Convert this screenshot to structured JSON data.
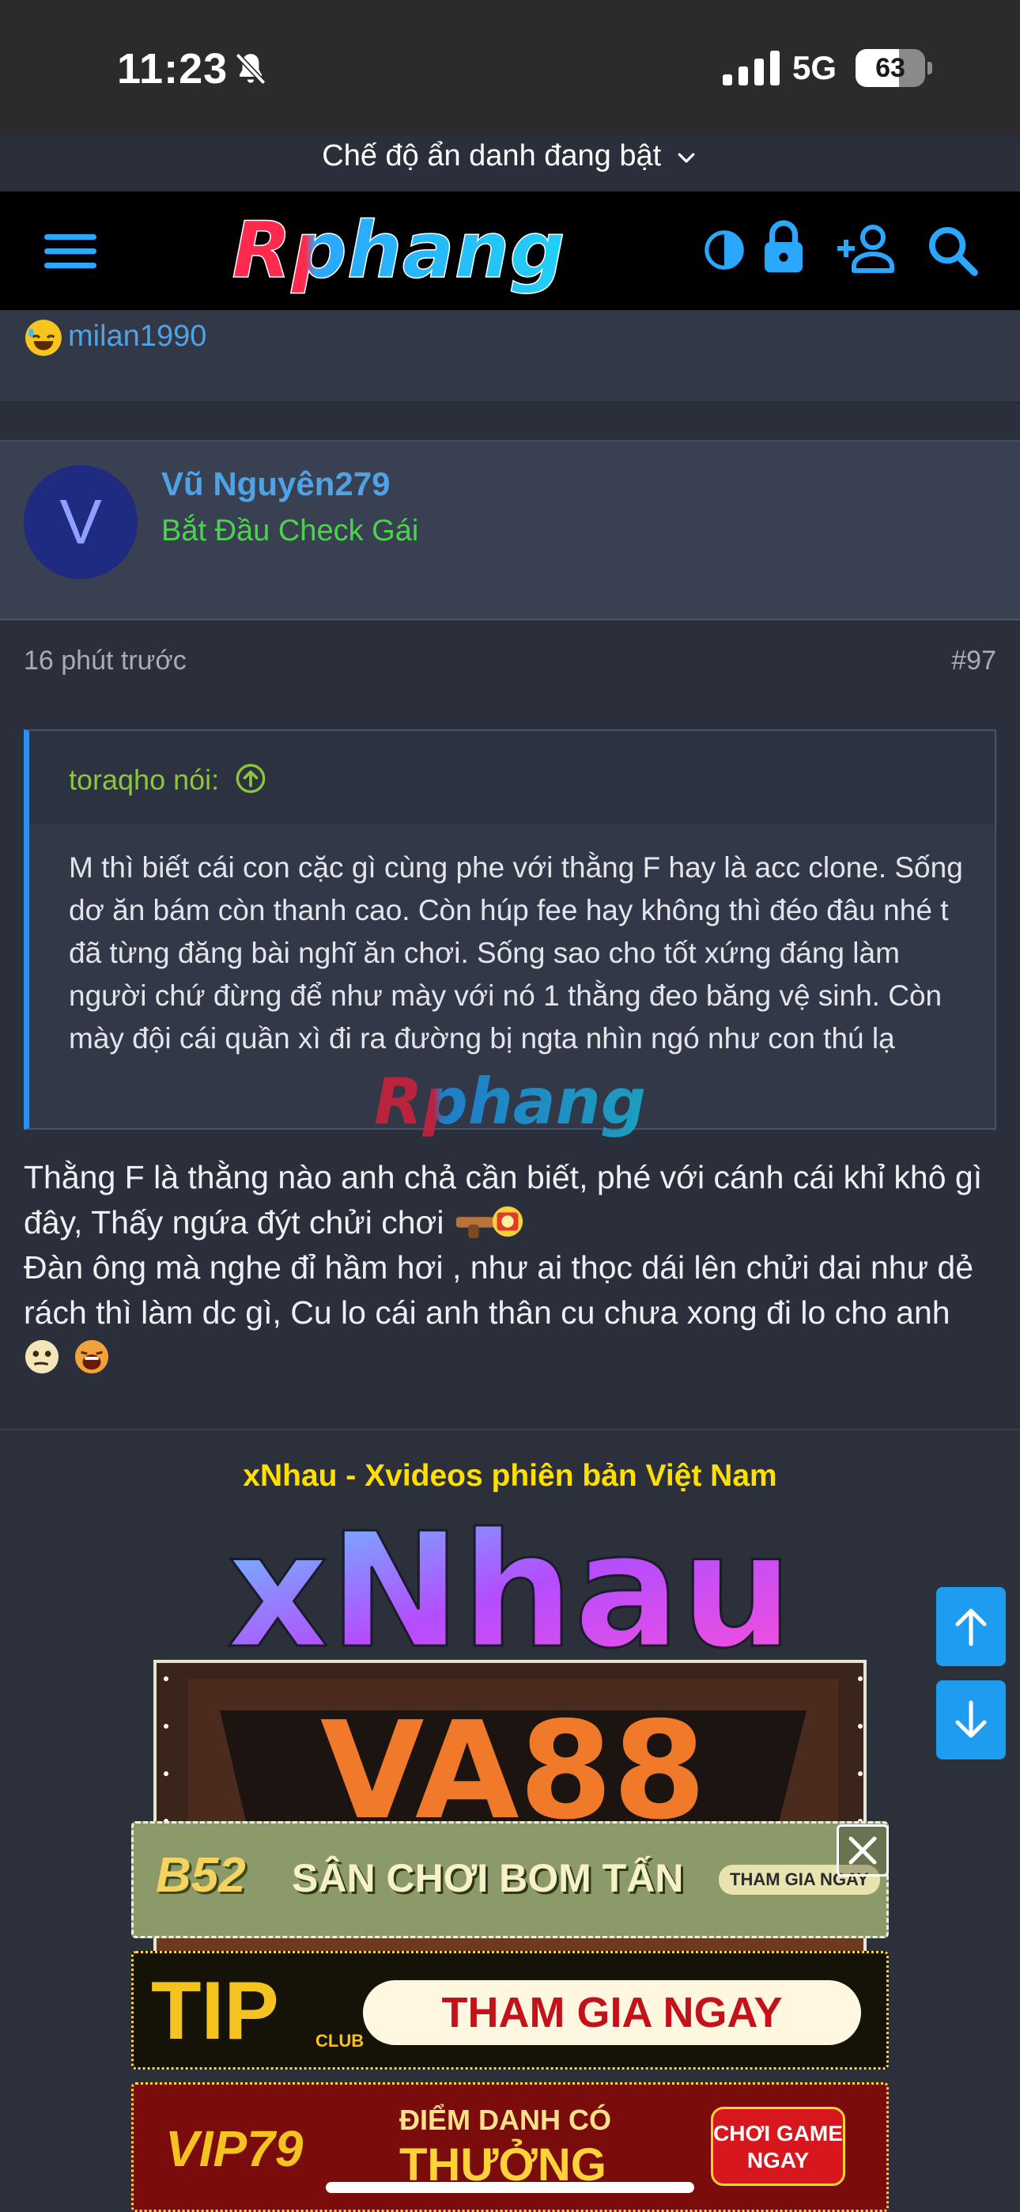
{
  "status_bar": {
    "time": "11:23",
    "network": "5G",
    "battery_level": "63",
    "battery_fraction": 0.63,
    "icons": [
      "bell-slash-icon",
      "signal-bars-icon",
      "battery-icon"
    ]
  },
  "browser": {
    "incognito_label": "Chế độ ẩn danh đang bật"
  },
  "header": {
    "logo_text": "Rphang",
    "icons": [
      "menu-icon",
      "theme-toggle-icon",
      "lock-icon",
      "user-add-icon",
      "search-icon"
    ]
  },
  "previous_post": {
    "reactor": "milan1990"
  },
  "post": {
    "avatar_letter": "V",
    "username": "Vũ Nguyên279",
    "user_title": "Bắt Đầu Check Gái",
    "time_ago": "16 phút trước",
    "post_number": "#97",
    "quote": {
      "author": "toraqho nói:",
      "text": "M thì biết cái con cặc gì cùng phe với thằng F hay là acc clone. Sống dơ ăn bám còn thanh cao. Còn húp fee hay không thì đéo đâu nhé t đã từng đăng bài nghĩ ăn chơi. Sống sao cho tốt xứng đáng làm người chứ đừng để như mày với nó 1 thằng đeo băng vệ sinh. Còn mày đội cái quần xì đi ra đường bị ngta nhìn ngó như con thú lạ"
    },
    "body_line1": "Thằng F là thằng nào anh chả cần biết, phé với cánh cái khỉ khô gì đây, Thấy ngứa đýt chửi chơi",
    "body_line2": "Đàn ông mà nghe đỉ hầm hơi , như ai thọc dái lên chửi dai như dẻ rách thì làm dc gì, Cu lo cái anh thân cu chưa xong đi lo cho anh"
  },
  "ads": {
    "title": "xNhau - Xvideos phiên bản Việt Nam",
    "xnhau_logo": "xNhau",
    "va88_logo": "VA88",
    "banner1_brand": "B52",
    "banner1_text": "SÂN CHƠI BOM TẤN",
    "banner1_cta": "THAM GIA NGAY",
    "banner2_brand": "TIP",
    "banner2_sub": "CLUB",
    "banner2_cta": "THAM GIA NGAY",
    "banner3_brand": "VIP79",
    "banner3_line1": "ĐIỂM DANH CÓ",
    "banner3_line2": "THƯỞNG",
    "banner3_cta": "CHƠI GAME NGAY"
  },
  "colors": {
    "link_blue": "#4ea3e6",
    "user_title_green": "#4bd44b",
    "quote_author_green": "#8cc63f",
    "quote_bar_blue": "#2f8ff0",
    "ad_title_yellow": "#ffdf00",
    "scroll_button_blue": "#1e9cf0"
  }
}
